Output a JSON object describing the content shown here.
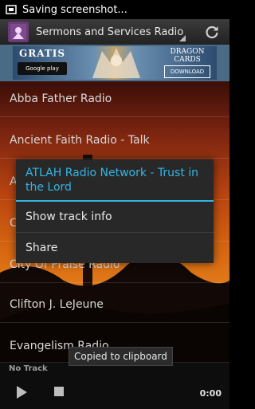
{
  "status_bar": {
    "icon": "screenshot-icon",
    "text": "Saving screenshot..."
  },
  "action_bar": {
    "app_icon": "app-logo-icon",
    "spinner_label": "Sermons and Services Radio",
    "refresh_icon": "refresh-icon"
  },
  "ad": {
    "gratis": "GRATIS",
    "store_badge": "Google play",
    "brand": "DRAGON CARDS",
    "download": "DOWNLOAD"
  },
  "stations": [
    "Abba Father Radio",
    "Ancient Faith Radio - Talk",
    "A",
    "C",
    "City Of Praise Radio",
    "Clifton J. LeJeune",
    "Evangelism Radio"
  ],
  "context_menu": {
    "title": "ATLAH Radio Network - Trust in the Lord",
    "items": [
      "Show track info",
      "Share"
    ],
    "accent": "#33b5e5"
  },
  "toast": "Copied to clipboard",
  "player": {
    "track": "No Track",
    "time": "0:00",
    "play_icon": "play-icon",
    "stop_icon": "stop-icon"
  }
}
